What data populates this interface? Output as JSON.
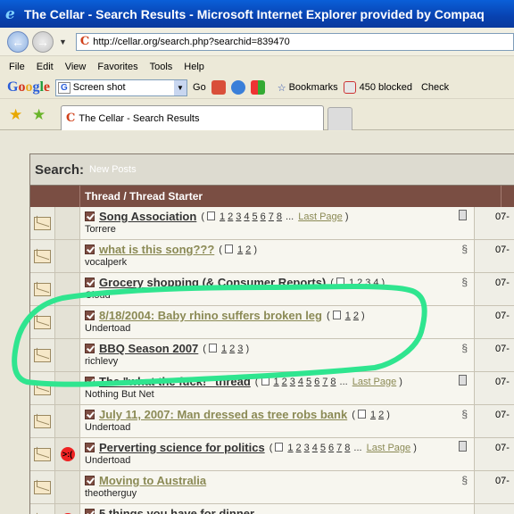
{
  "window": {
    "title": "The Cellar - Search Results - Microsoft Internet Explorer provided by Compaq"
  },
  "address": {
    "url": "http://cellar.org/search.php?searchid=839470"
  },
  "menu": [
    "File",
    "Edit",
    "View",
    "Favorites",
    "Tools",
    "Help"
  ],
  "google_toolbar": {
    "logo": [
      "G",
      "o",
      "o",
      "g",
      "l",
      "e"
    ],
    "search_value": "Screen shot",
    "go_label": "Go",
    "bookmarks_label": "Bookmarks",
    "blocked_label": "450 blocked",
    "check_label": "Check"
  },
  "tab": {
    "title": "The Cellar - Search Results"
  },
  "search": {
    "heading": "Search:",
    "subheading": "New Posts",
    "column_header": "Thread / Thread Starter"
  },
  "threads": [
    {
      "title": "Song Association",
      "starter": "Torrere",
      "pages": [
        "1",
        "2",
        "3",
        "4",
        "5",
        "6",
        "7",
        "8"
      ],
      "ellipsis": "...",
      "last_page": "Last Page",
      "visited": false,
      "date": "07-"
    },
    {
      "title": "what is this song???",
      "starter": "vocalperk",
      "pages": [
        "1",
        "2"
      ],
      "visited": true,
      "date": "07-"
    },
    {
      "title": "Grocery shopping (& Consumer Reports)",
      "starter": "Cloud",
      "pages": [
        "1",
        "2",
        "3",
        "4"
      ],
      "visited": false,
      "date": "07-"
    },
    {
      "title": "8/18/2004: Baby rhino suffers broken leg",
      "starter": "Undertoad",
      "pages": [
        "1",
        "2"
      ],
      "visited": true,
      "date": "07-"
    },
    {
      "title": "BBQ Season 2007",
      "starter": "richlevy",
      "pages": [
        "1",
        "2",
        "3"
      ],
      "visited": false,
      "date": "07-"
    },
    {
      "title": "The \"what the fuck!\" thread",
      "starter": "Nothing But Net",
      "pages": [
        "1",
        "2",
        "3",
        "4",
        "5",
        "6",
        "7",
        "8"
      ],
      "ellipsis": "...",
      "last_page": "Last Page",
      "visited": false,
      "date": "07-"
    },
    {
      "title": "July 11, 2007: Man dressed as tree robs bank",
      "starter": "Undertoad",
      "pages": [
        "1",
        "2"
      ],
      "visited": true,
      "date": "07-"
    },
    {
      "title": "Perverting science for politics",
      "starter": "Undertoad",
      "pages": [
        "1",
        "2",
        "3",
        "4",
        "5",
        "6",
        "7",
        "8"
      ],
      "ellipsis": "...",
      "last_page": "Last Page",
      "visited": false,
      "date": "07-"
    },
    {
      "title": "Moving to Australia",
      "starter": "theotherguy",
      "pages": [],
      "visited": true,
      "date": "07-"
    },
    {
      "title": "5 things you have for dinner",
      "starter": "",
      "pages": [],
      "visited": false,
      "date": ""
    }
  ],
  "colors": {
    "highlight": "#2fe58f",
    "header_bg": "#7a4e43",
    "visited_link": "#8b8a55"
  }
}
